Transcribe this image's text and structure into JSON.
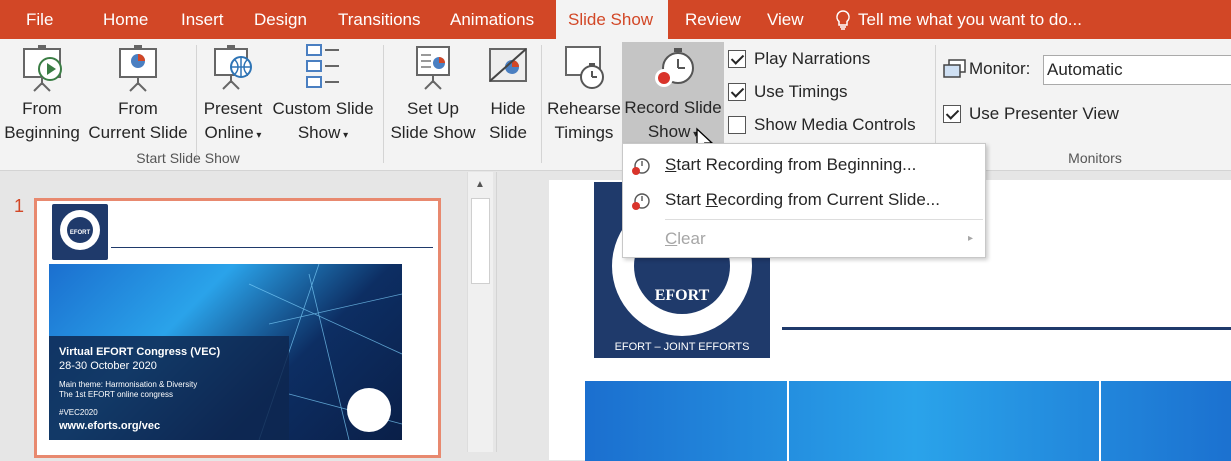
{
  "tabs": {
    "file": "File",
    "home": "Home",
    "insert": "Insert",
    "design": "Design",
    "transitions": "Transitions",
    "animations": "Animations",
    "slideshow": "Slide Show",
    "review": "Review",
    "view": "View"
  },
  "tell": "Tell me what you want to do...",
  "ribbon": {
    "from_beginning": [
      "From",
      "Beginning"
    ],
    "from_current": [
      "From",
      "Current Slide"
    ],
    "present_online": [
      "Present",
      "Online"
    ],
    "custom_show": [
      "Custom Slide",
      "Show"
    ],
    "setup": [
      "Set Up",
      "Slide Show"
    ],
    "hide": [
      "Hide",
      "Slide"
    ],
    "rehearse": [
      "Rehearse",
      "Timings"
    ],
    "record": [
      "Record Slide",
      "Show"
    ],
    "play_narrations": "Play Narrations",
    "use_timings": "Use Timings",
    "show_media": "Show Media Controls",
    "monitor_label": "Monitor:",
    "monitor_value": "Automatic",
    "presenter_view": "Use Presenter View",
    "group_start": "Start Slide Show",
    "group_monitors": "Monitors"
  },
  "checks": {
    "play_narrations": true,
    "use_timings": true,
    "show_media": false,
    "presenter_view": true
  },
  "menu": {
    "start_begin_pre": "S",
    "start_begin_post": "tart Recording from Beginning...",
    "start_cur_pre": "Start ",
    "start_cur_u": "R",
    "start_cur_post": "ecording from Current Slide...",
    "clear_u": "C",
    "clear_post": "lear"
  },
  "slide_number": "1",
  "slide": {
    "congress": "Virtual EFORT Congress (VEC)",
    "dates": "28-30 October 2020",
    "theme": "Main theme: Harmonisation & Diversity",
    "first": "The 1st EFORT online congress",
    "hashtag": "#VEC2020",
    "url": "www.eforts.org/vec",
    "logo": "EFORT",
    "logo_ring": "EFORT – JOINT EFFORTS"
  }
}
